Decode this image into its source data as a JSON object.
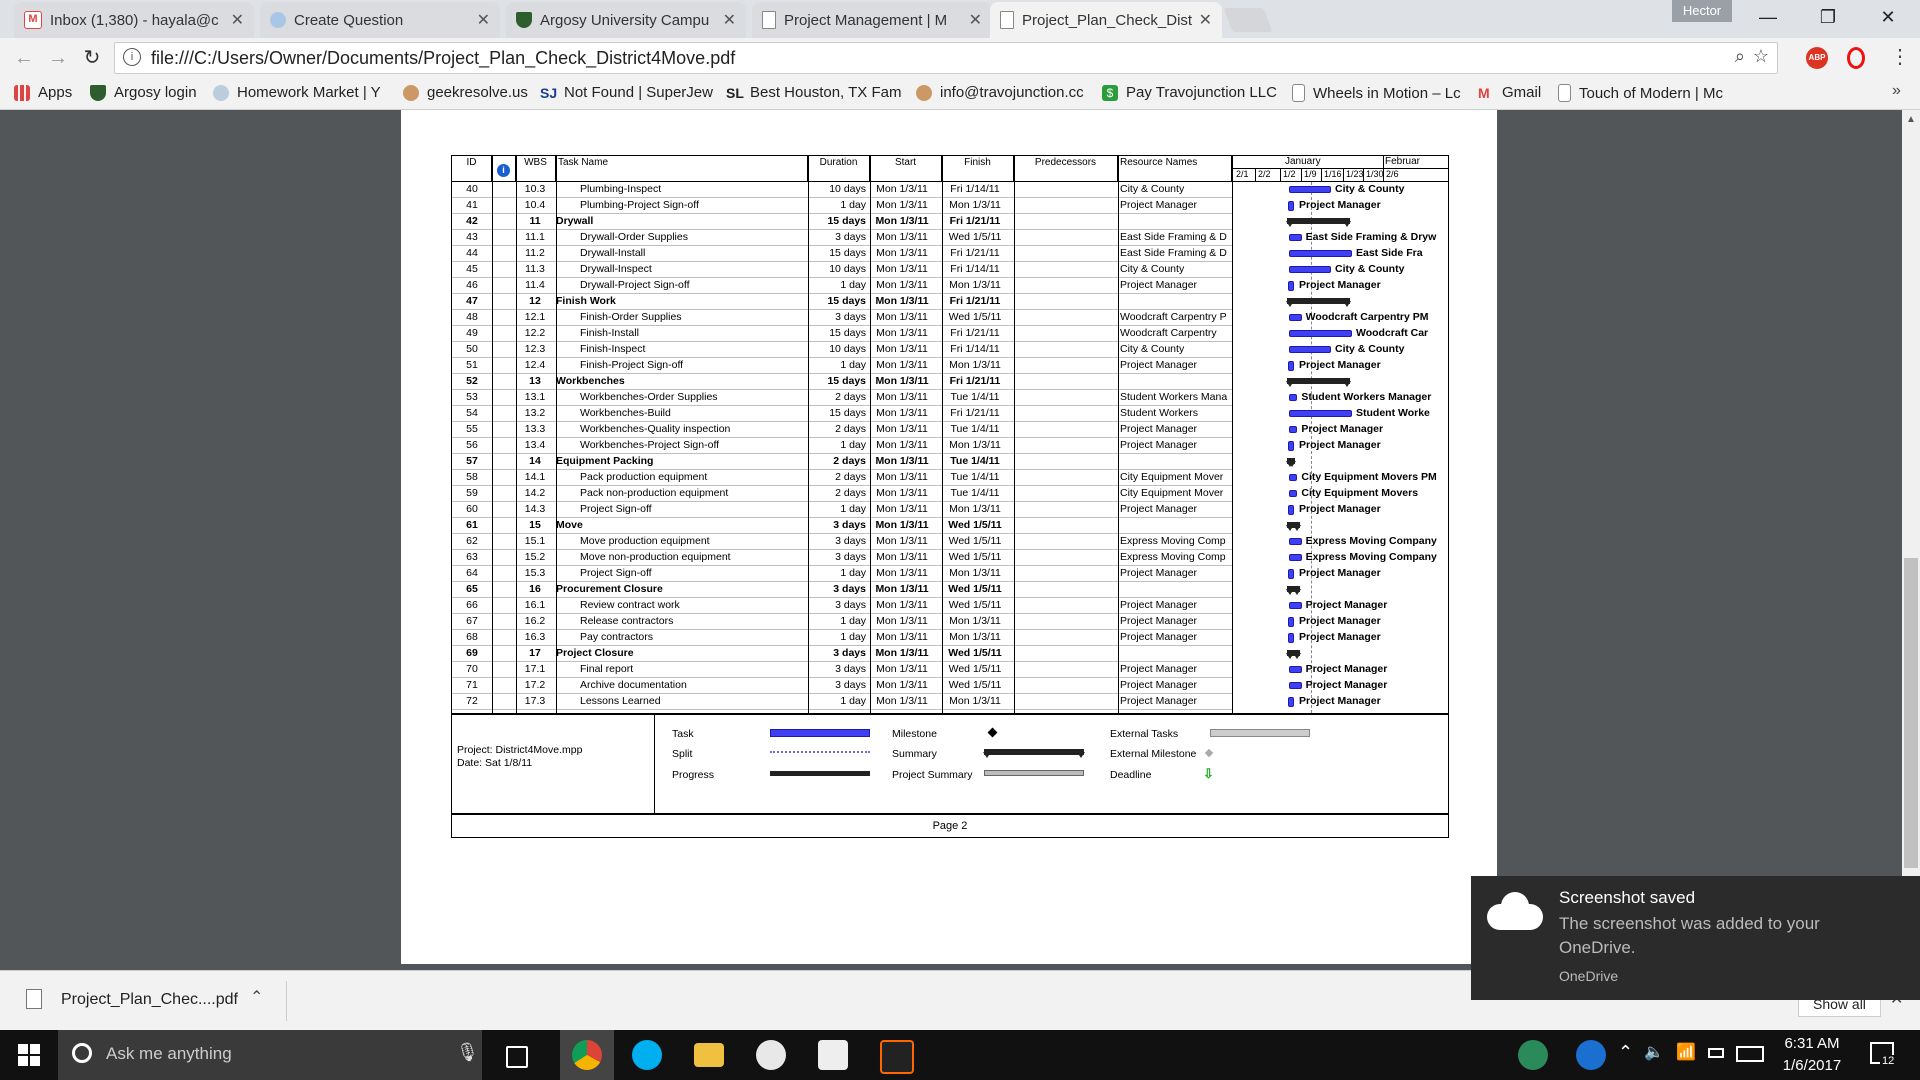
{
  "tabs": [
    {
      "label": "Inbox (1,380) - hayala@c",
      "icon": "gmail-icon",
      "active": false
    },
    {
      "label": "Create Question",
      "icon": "create-question-icon",
      "active": false
    },
    {
      "label": "Argosy University Campu",
      "icon": "argosy-shield-icon",
      "active": false
    },
    {
      "label": "Project Management | M",
      "icon": "document-icon",
      "active": false
    },
    {
      "label": "Project_Plan_Check_Distr",
      "icon": "document-icon",
      "active": true
    }
  ],
  "profile": "Hector",
  "address_bar": {
    "url": "file:///C:/Users/Owner/Documents/Project_Plan_Check_District4Move.pdf"
  },
  "bookmarks": [
    {
      "label": "Apps",
      "icon": "apps-grid-icon"
    },
    {
      "label": "Argosy login",
      "icon": "argosy-shield-icon"
    },
    {
      "label": "Homework Market | Y",
      "icon": "homework-market-icon"
    },
    {
      "label": "geekresolve.us",
      "icon": "geek-icon"
    },
    {
      "label": "Not Found | SuperJew",
      "icon": "sj-icon"
    },
    {
      "label": "Best Houston, TX Fam",
      "icon": "sl-icon"
    },
    {
      "label": "info@travojunction.cc",
      "icon": "geek-icon"
    },
    {
      "label": "Pay Travojunction LLC",
      "icon": "dollar-icon"
    },
    {
      "label": "Wheels in Motion – Lc",
      "icon": "document-icon"
    },
    {
      "label": "Gmail",
      "icon": "gmail-icon"
    },
    {
      "label": "Touch of Modern | Mc",
      "icon": "document-icon"
    }
  ],
  "gantt": {
    "headers": {
      "id": "ID",
      "wbs": "WBS",
      "task_name": "Task Name",
      "duration": "Duration",
      "start": "Start",
      "finish": "Finish",
      "predecessors": "Predecessors",
      "resources": "Resource Names"
    },
    "timescale": {
      "months": [
        "January",
        "Februar"
      ],
      "weeks": [
        "2/1",
        "2/2",
        "1/2",
        "1/9",
        "1/16",
        "1/23",
        "1/30",
        "2/6"
      ]
    },
    "rows": [
      {
        "id": "40",
        "wbs": "10.3",
        "name": "Plumbing-Inspect",
        "duration": "10 days",
        "start": "Mon 1/3/11",
        "finish": "Fri 1/14/11",
        "resources": "City & County",
        "summary": false
      },
      {
        "id": "41",
        "wbs": "10.4",
        "name": "Plumbing-Project Sign-off",
        "duration": "1 day",
        "start": "Mon 1/3/11",
        "finish": "Mon 1/3/11",
        "resources": "Project Manager",
        "summary": false
      },
      {
        "id": "42",
        "wbs": "11",
        "name": "Drywall",
        "duration": "15 days",
        "start": "Mon 1/3/11",
        "finish": "Fri 1/21/11",
        "resources": "",
        "summary": true
      },
      {
        "id": "43",
        "wbs": "11.1",
        "name": "Drywall-Order Supplies",
        "duration": "3 days",
        "start": "Mon 1/3/11",
        "finish": "Wed 1/5/11",
        "resources": "East Side Framing & D",
        "summary": false
      },
      {
        "id": "44",
        "wbs": "11.2",
        "name": "Drywall-Install",
        "duration": "15 days",
        "start": "Mon 1/3/11",
        "finish": "Fri 1/21/11",
        "resources": "East Side Framing & D",
        "summary": false
      },
      {
        "id": "45",
        "wbs": "11.3",
        "name": "Drywall-Inspect",
        "duration": "10 days",
        "start": "Mon 1/3/11",
        "finish": "Fri 1/14/11",
        "resources": "City & County",
        "summary": false
      },
      {
        "id": "46",
        "wbs": "11.4",
        "name": "Drywall-Project Sign-off",
        "duration": "1 day",
        "start": "Mon 1/3/11",
        "finish": "Mon 1/3/11",
        "resources": "Project Manager",
        "summary": false
      },
      {
        "id": "47",
        "wbs": "12",
        "name": "Finish Work",
        "duration": "15 days",
        "start": "Mon 1/3/11",
        "finish": "Fri 1/21/11",
        "resources": "",
        "summary": true
      },
      {
        "id": "48",
        "wbs": "12.1",
        "name": "Finish-Order Supplies",
        "duration": "3 days",
        "start": "Mon 1/3/11",
        "finish": "Wed 1/5/11",
        "resources": "Woodcraft Carpentry P",
        "summary": false
      },
      {
        "id": "49",
        "wbs": "12.2",
        "name": "Finish-Install",
        "duration": "15 days",
        "start": "Mon 1/3/11",
        "finish": "Fri 1/21/11",
        "resources": "Woodcraft Carpentry",
        "summary": false
      },
      {
        "id": "50",
        "wbs": "12.3",
        "name": "Finish-Inspect",
        "duration": "10 days",
        "start": "Mon 1/3/11",
        "finish": "Fri 1/14/11",
        "resources": "City & County",
        "summary": false
      },
      {
        "id": "51",
        "wbs": "12.4",
        "name": "Finish-Project Sign-off",
        "duration": "1 day",
        "start": "Mon 1/3/11",
        "finish": "Mon 1/3/11",
        "resources": "Project Manager",
        "summary": false
      },
      {
        "id": "52",
        "wbs": "13",
        "name": "Workbenches",
        "duration": "15 days",
        "start": "Mon 1/3/11",
        "finish": "Fri 1/21/11",
        "resources": "",
        "summary": true
      },
      {
        "id": "53",
        "wbs": "13.1",
        "name": "Workbenches-Order Supplies",
        "duration": "2 days",
        "start": "Mon 1/3/11",
        "finish": "Tue 1/4/11",
        "resources": "Student Workers Mana",
        "summary": false
      },
      {
        "id": "54",
        "wbs": "13.2",
        "name": "Workbenches-Build",
        "duration": "15 days",
        "start": "Mon 1/3/11",
        "finish": "Fri 1/21/11",
        "resources": "Student Workers",
        "summary": false
      },
      {
        "id": "55",
        "wbs": "13.3",
        "name": "Workbenches-Quality inspection",
        "duration": "2 days",
        "start": "Mon 1/3/11",
        "finish": "Tue 1/4/11",
        "resources": "Project Manager",
        "summary": false
      },
      {
        "id": "56",
        "wbs": "13.4",
        "name": "Workbenches-Project Sign-off",
        "duration": "1 day",
        "start": "Mon 1/3/11",
        "finish": "Mon 1/3/11",
        "resources": "Project Manager",
        "summary": false
      },
      {
        "id": "57",
        "wbs": "14",
        "name": "Equipment Packing",
        "duration": "2 days",
        "start": "Mon 1/3/11",
        "finish": "Tue 1/4/11",
        "resources": "",
        "summary": true
      },
      {
        "id": "58",
        "wbs": "14.1",
        "name": "Pack production equipment",
        "duration": "2 days",
        "start": "Mon 1/3/11",
        "finish": "Tue 1/4/11",
        "resources": "City Equipment Mover",
        "summary": false
      },
      {
        "id": "59",
        "wbs": "14.2",
        "name": "Pack non-production equipment",
        "duration": "2 days",
        "start": "Mon 1/3/11",
        "finish": "Tue 1/4/11",
        "resources": "City Equipment Mover",
        "summary": false
      },
      {
        "id": "60",
        "wbs": "14.3",
        "name": "Project Sign-off",
        "duration": "1 day",
        "start": "Mon 1/3/11",
        "finish": "Mon 1/3/11",
        "resources": "Project Manager",
        "summary": false
      },
      {
        "id": "61",
        "wbs": "15",
        "name": "Move",
        "duration": "3 days",
        "start": "Mon 1/3/11",
        "finish": "Wed 1/5/11",
        "resources": "",
        "summary": true
      },
      {
        "id": "62",
        "wbs": "15.1",
        "name": "Move production equipment",
        "duration": "3 days",
        "start": "Mon 1/3/11",
        "finish": "Wed 1/5/11",
        "resources": "Express Moving Comp",
        "summary": false
      },
      {
        "id": "63",
        "wbs": "15.2",
        "name": "Move non-production equipment",
        "duration": "3 days",
        "start": "Mon 1/3/11",
        "finish": "Wed 1/5/11",
        "resources": "Express Moving Comp",
        "summary": false
      },
      {
        "id": "64",
        "wbs": "15.3",
        "name": "Project Sign-off",
        "duration": "1 day",
        "start": "Mon 1/3/11",
        "finish": "Mon 1/3/11",
        "resources": "Project Manager",
        "summary": false
      },
      {
        "id": "65",
        "wbs": "16",
        "name": "Procurement Closure",
        "duration": "3 days",
        "start": "Mon 1/3/11",
        "finish": "Wed 1/5/11",
        "resources": "",
        "summary": true
      },
      {
        "id": "66",
        "wbs": "16.1",
        "name": "Review contract work",
        "duration": "3 days",
        "start": "Mon 1/3/11",
        "finish": "Wed 1/5/11",
        "resources": "Project Manager",
        "summary": false
      },
      {
        "id": "67",
        "wbs": "16.2",
        "name": "Release contractors",
        "duration": "1 day",
        "start": "Mon 1/3/11",
        "finish": "Mon 1/3/11",
        "resources": "Project Manager",
        "summary": false
      },
      {
        "id": "68",
        "wbs": "16.3",
        "name": "Pay contractors",
        "duration": "1 day",
        "start": "Mon 1/3/11",
        "finish": "Mon 1/3/11",
        "resources": "Project Manager",
        "summary": false
      },
      {
        "id": "69",
        "wbs": "17",
        "name": "Project Closure",
        "duration": "3 days",
        "start": "Mon 1/3/11",
        "finish": "Wed 1/5/11",
        "resources": "",
        "summary": true
      },
      {
        "id": "70",
        "wbs": "17.1",
        "name": "Final report",
        "duration": "3 days",
        "start": "Mon 1/3/11",
        "finish": "Wed 1/5/11",
        "resources": "Project Manager",
        "summary": false
      },
      {
        "id": "71",
        "wbs": "17.2",
        "name": "Archive documentation",
        "duration": "3 days",
        "start": "Mon 1/3/11",
        "finish": "Wed 1/5/11",
        "resources": "Project Manager",
        "summary": false
      },
      {
        "id": "72",
        "wbs": "17.3",
        "name": "Lessons Learned",
        "duration": "1 day",
        "start": "Mon 1/3/11",
        "finish": "Mon 1/3/11",
        "resources": "Project Manager",
        "summary": false
      }
    ],
    "bar_labels": [
      "City & County",
      "Project Manager",
      "",
      "East Side Framing & Dryw",
      "East Side Fra",
      "City & County",
      "Project Manager",
      "",
      "Woodcraft Carpentry PM",
      "Woodcraft Car",
      "City & County",
      "Project Manager",
      "",
      "Student Workers Manager",
      "Student Worke",
      "Project Manager",
      "Project Manager",
      "",
      "City Equipment Movers PM",
      "City Equipment Movers",
      "Project Manager",
      "",
      "Express Moving Company",
      "Express Moving Company",
      "Project Manager",
      "",
      "Project Manager",
      "Project Manager",
      "Project Manager",
      "",
      "Project Manager",
      "Project Manager",
      "Project Manager"
    ]
  },
  "legend": {
    "project": "Project: District4Move.mpp",
    "date": "Date: Sat 1/8/11",
    "task": "Task",
    "split": "Split",
    "progress": "Progress",
    "milestone": "Milestone",
    "summary": "Summary",
    "project_summary": "Project Summary",
    "external_tasks": "External Tasks",
    "external_milestone": "External Milestone",
    "deadline": "Deadline"
  },
  "page_footer": "Page 2",
  "download": {
    "filename": "Project_Plan_Chec....pdf",
    "show_all": "Show all"
  },
  "toast": {
    "title": "Screenshot saved",
    "body": "The screenshot was added to your OneDrive.",
    "source": "OneDrive"
  },
  "taskbar": {
    "search_placeholder": "Ask me anything",
    "time": "6:31 AM",
    "date": "1/6/2017",
    "notifications": "12"
  }
}
